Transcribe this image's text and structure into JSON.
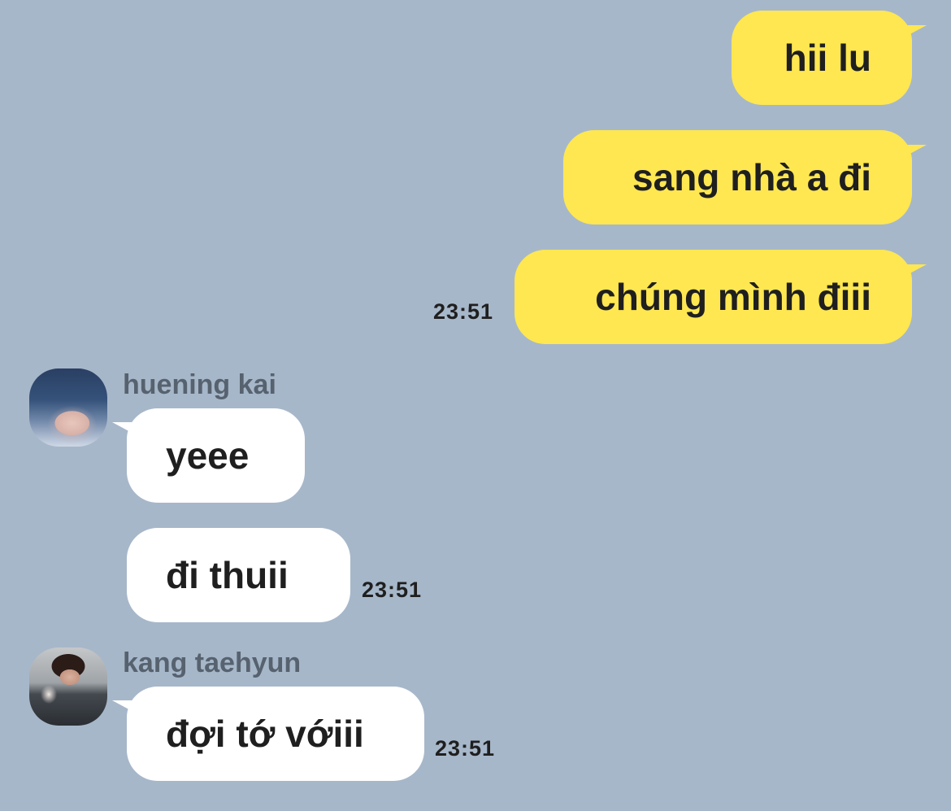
{
  "theme": {
    "background": "#a7b7ca",
    "outgoing_bubble": "#fee751",
    "incoming_bubble": "#ffffff",
    "sender_name_color": "#57626f"
  },
  "messages": {
    "out_1": "hii lu",
    "out_2": "sang nhà a đi",
    "out_3": "chúng mình điii",
    "out_time": "23:51",
    "kai_name": "huening kai",
    "kai_avatar": "profile-photo",
    "kai_1": "yeee",
    "kai_2": "đi thuii",
    "kai_time": "23:51",
    "taehyun_name": "kang taehyun",
    "taehyun_avatar": "profile-photo",
    "taehyun_1": "đợi tớ vớiii",
    "taehyun_time": "23:51"
  }
}
